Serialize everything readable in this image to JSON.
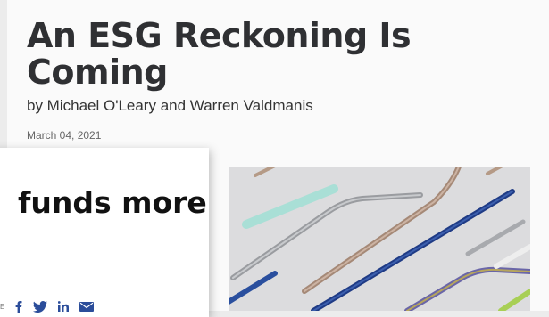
{
  "article": {
    "title": "An ESG Reckoning Is Coming",
    "byline": "by Michael O'Leary and Warren Valdmanis",
    "date": "March 04, 2021"
  },
  "promo": {
    "headline": "funds more",
    "share_label": "E",
    "share_icons": [
      "facebook-icon",
      "twitter-icon",
      "linkedin-icon",
      "email-icon"
    ]
  },
  "image": {
    "subject": "metal straws",
    "background_color": "#dcdcde"
  },
  "colors": {
    "page_background": "#fafafa",
    "title_text": "#2f3033",
    "share_icon": "#2b4d9a"
  }
}
